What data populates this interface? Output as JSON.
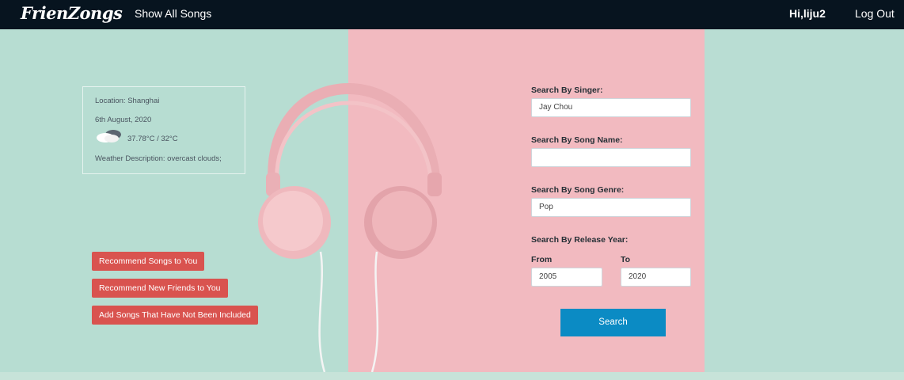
{
  "navbar": {
    "brand": "FrienZongs",
    "show_all": "Show All Songs",
    "greeting": "Hi,liju2",
    "logout": "Log Out"
  },
  "weather": {
    "location": "Location: Shanghai",
    "date": "6th August, 2020",
    "temperature": "37.78°C / 32°C",
    "description": "Weather Description: overcast clouds;",
    "icon": "cloud-icon"
  },
  "actions": {
    "recommend_songs": "Recommend Songs to You",
    "recommend_friends": "Recommend New Friends to You",
    "add_songs": "Add Songs That Have Not Been Included"
  },
  "search": {
    "singer_label": "Search By Singer:",
    "singer_value": "Jay Chou",
    "song_name_label": "Search By Song Name:",
    "song_name_value": "",
    "genre_label": "Search By Song Genre:",
    "genre_value": "Pop",
    "year_label": "Search By Release Year:",
    "from_label": "From",
    "from_value": "2005",
    "to_label": "To",
    "to_value": "2020",
    "button": "Search"
  },
  "colors": {
    "navbar": "#07141f",
    "mint": "#b7ddd2",
    "pink": "#f2bac0",
    "button_red": "#d9534f",
    "search_blue": "#0b8bc4"
  }
}
